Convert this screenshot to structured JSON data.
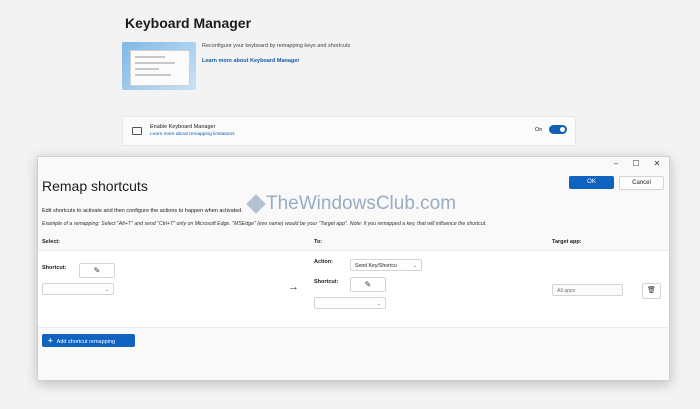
{
  "settings": {
    "title": "Keyboard Manager",
    "description": "Reconfigure your keyboard by remapping keys and shortcuts",
    "learn_more": "Learn more about Keyboard Manager",
    "enable_label": "Enable Keyboard Manager",
    "limitations_link": "Learn more about remapping limitations",
    "toggle_state": "On"
  },
  "dialog": {
    "window_buttons": {
      "minimize": "–",
      "maximize": "☐",
      "close": "✕"
    },
    "title": "Remap shortcuts",
    "ok_label": "OK",
    "cancel_label": "Cancel",
    "instruction": "Edit shortcuts to activate and then configure the actions to happen when activated.",
    "example": "Example of a remapping: Select \"Alt+T\" and send \"Ctrl+T\" only on Microsoft Edge. \"MSEdge\" (exe name) would be your \"Target app\". Note: if you remapped a key, that will influence the shortcut.",
    "columns": {
      "select": "Select:",
      "to": "To:",
      "target_app": "Target app:"
    },
    "row": {
      "shortcut_label": "Shortcut:",
      "action_label": "Action:",
      "action_value": "Send Key/Shortcu",
      "target_shortcut_label": "Shortcut:",
      "target_app_placeholder": "All apps"
    },
    "add_button": "Add shortcut remapping"
  },
  "watermark": "TheWindowsClub.com",
  "icons": {
    "pencil": "✎",
    "arrow": "→",
    "chevron": "⌄",
    "trash": "🗑",
    "plus": "+"
  },
  "colors": {
    "accent": "#0f62c0",
    "link": "#0f5ca8"
  }
}
